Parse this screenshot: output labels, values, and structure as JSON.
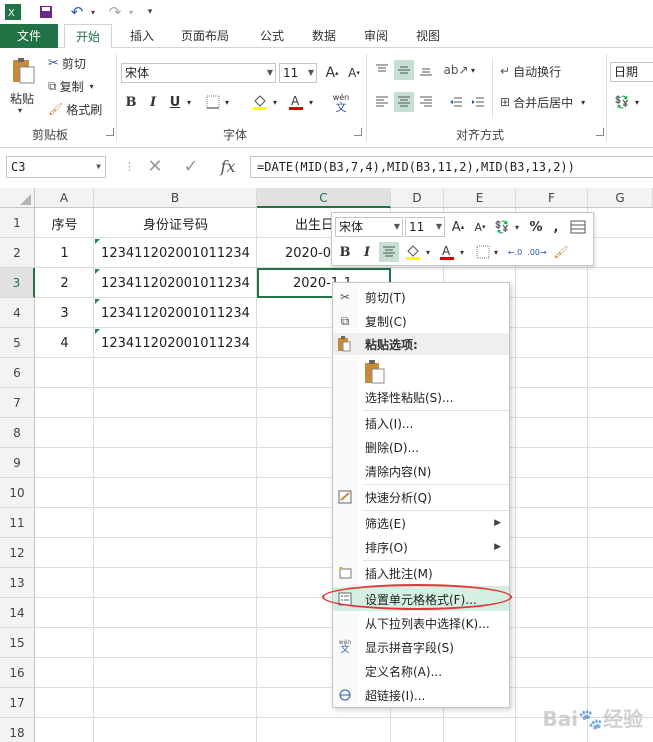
{
  "qat": {
    "undo_icon": "undo-icon",
    "redo_icon": "redo-icon"
  },
  "tabs": [
    {
      "label": "文件"
    },
    {
      "label": "开始"
    },
    {
      "label": "插入"
    },
    {
      "label": "页面布局"
    },
    {
      "label": "公式"
    },
    {
      "label": "数据"
    },
    {
      "label": "审阅"
    },
    {
      "label": "视图"
    }
  ],
  "ribbon": {
    "paste": "粘贴",
    "cut": "剪切",
    "copy": "复制",
    "format_painter": "格式刷",
    "clipboard_group": "剪贴板",
    "font_name": "宋体",
    "font_size": "11",
    "font_group": "字体",
    "bold": "B",
    "italic": "I",
    "underline": "U",
    "phonetic": "wén",
    "phonetic_sub": "文",
    "wrap_text": "自动换行",
    "merge_center": "合并后居中",
    "align_group": "对齐方式",
    "number_format": "日期"
  },
  "formula_bar": {
    "name_box": "C3",
    "fx": "fx",
    "formula": "=DATE(MID(B3,7,4),MID(B3,11,2),MID(B3,13,2))"
  },
  "columns": [
    "A",
    "B",
    "C",
    "D",
    "E",
    "F",
    "G"
  ],
  "rows": [
    "1",
    "2",
    "3",
    "4",
    "5",
    "6",
    "7",
    "8",
    "9",
    "10",
    "11",
    "12",
    "13",
    "14",
    "15",
    "16",
    "17",
    "18"
  ],
  "cells": {
    "A1": "序号",
    "B1": "身份证号码",
    "C1": "出生日",
    "A2": "1",
    "B2": "123411202001011234",
    "C2": "2020-0",
    "A3": "2",
    "B3": "123411202001011234",
    "C3": "2020-1-1",
    "A4": "3",
    "B4": "123411202001011234",
    "A5": "4",
    "B5": "123411202001011234"
  },
  "mini_toolbar": {
    "font_name": "宋体",
    "font_size": "11",
    "percent": "%",
    "comma": ",",
    "bold": "B",
    "italic": "I"
  },
  "context_menu": {
    "cut": "剪切(T)",
    "copy": "复制(C)",
    "paste_options": "粘贴选项:",
    "paste_special": "选择性粘贴(S)...",
    "insert": "插入(I)...",
    "delete": "删除(D)...",
    "clear": "清除内容(N)",
    "quick_analysis": "快速分析(Q)",
    "filter": "筛选(E)",
    "sort": "排序(O)",
    "insert_comment": "插入批注(M)",
    "format_cells": "设置单元格格式(F)...",
    "pick_list": "从下拉列表中选择(K)...",
    "phonetic": "显示拼音字段(S)",
    "define_name": "定义名称(A)...",
    "hyperlink": "超链接(I)..."
  },
  "colors": {
    "accent": "#217346",
    "highlight_oval": "#e0383a",
    "hover": "#d3f0e0"
  }
}
